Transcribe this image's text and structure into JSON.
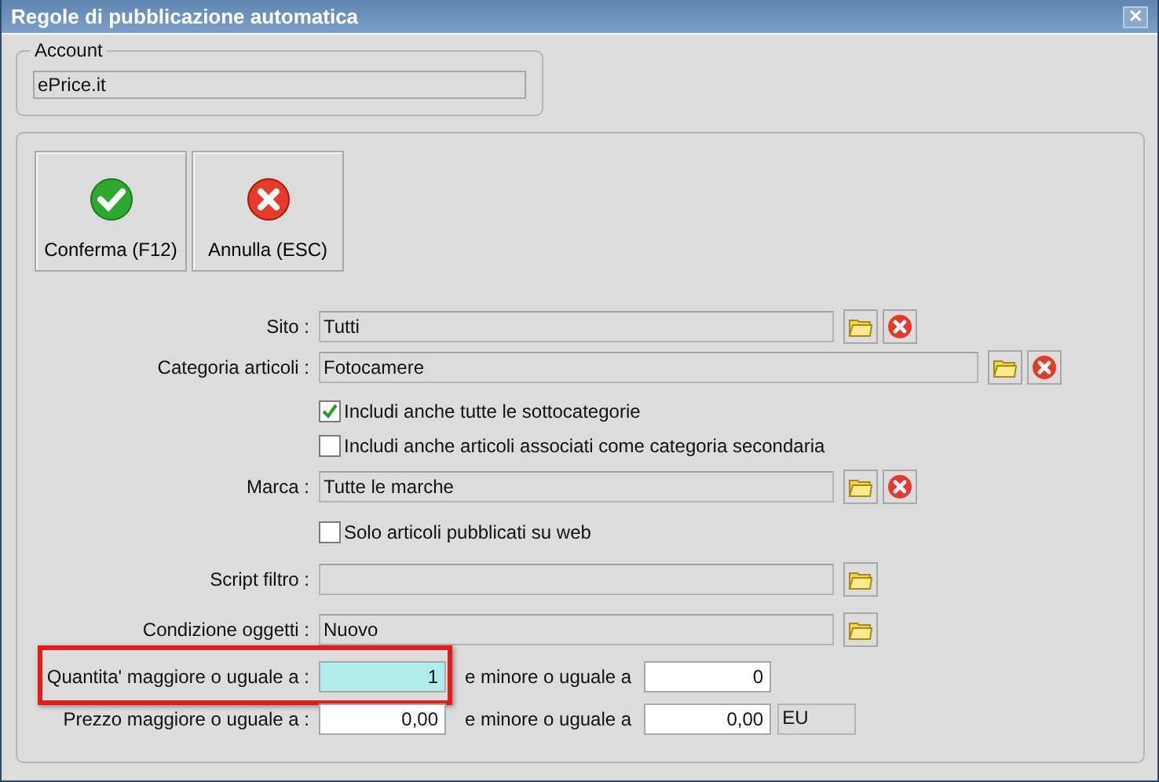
{
  "window": {
    "title": "Regole di pubblicazione automatica",
    "close": "✕"
  },
  "account": {
    "legend": "Account",
    "value": "ePrice.it"
  },
  "buttons": [
    {
      "kind": "confirm",
      "label": "Conferma (F12)"
    },
    {
      "kind": "cancel",
      "label": "Annulla (ESC)"
    }
  ],
  "rows": [
    {
      "kind": "lookup",
      "label": "Sito :",
      "value": "Tutti",
      "clear": true
    },
    {
      "kind": "lookup",
      "label": "Categoria articoli :",
      "value": "Fotocamere",
      "clear": true
    },
    {
      "kind": "checkbox",
      "label": "Includi anche tutte le sottocategorie",
      "checked": true
    },
    {
      "kind": "checkbox",
      "label": "Includi anche articoli associati come categoria secondaria",
      "checked": false
    },
    {
      "kind": "lookup",
      "label": "Marca :",
      "value": "Tutte le marche",
      "clear": true
    },
    {
      "kind": "checkbox",
      "label": "Solo articoli pubblicati su web",
      "checked": false
    },
    {
      "kind": "lookup",
      "label": "Script filtro :",
      "clear": false
    },
    {
      "kind": "lookup",
      "label": "Condizione oggetti :",
      "value": "Nuovo",
      "clear": false
    },
    {
      "kind": "range",
      "label": "Quantita' maggiore o uguale a :",
      "from": "1",
      "to_label": "e minore o uguale a",
      "to": "0",
      "focused": true,
      "highlighted": true
    },
    {
      "kind": "range",
      "label": "Prezzo maggiore o uguale a :",
      "from": "0,00",
      "to_label": "e minore o uguale a",
      "to": "0,00",
      "unit": "EU",
      "focused": false,
      "highlighted": false
    }
  ]
}
